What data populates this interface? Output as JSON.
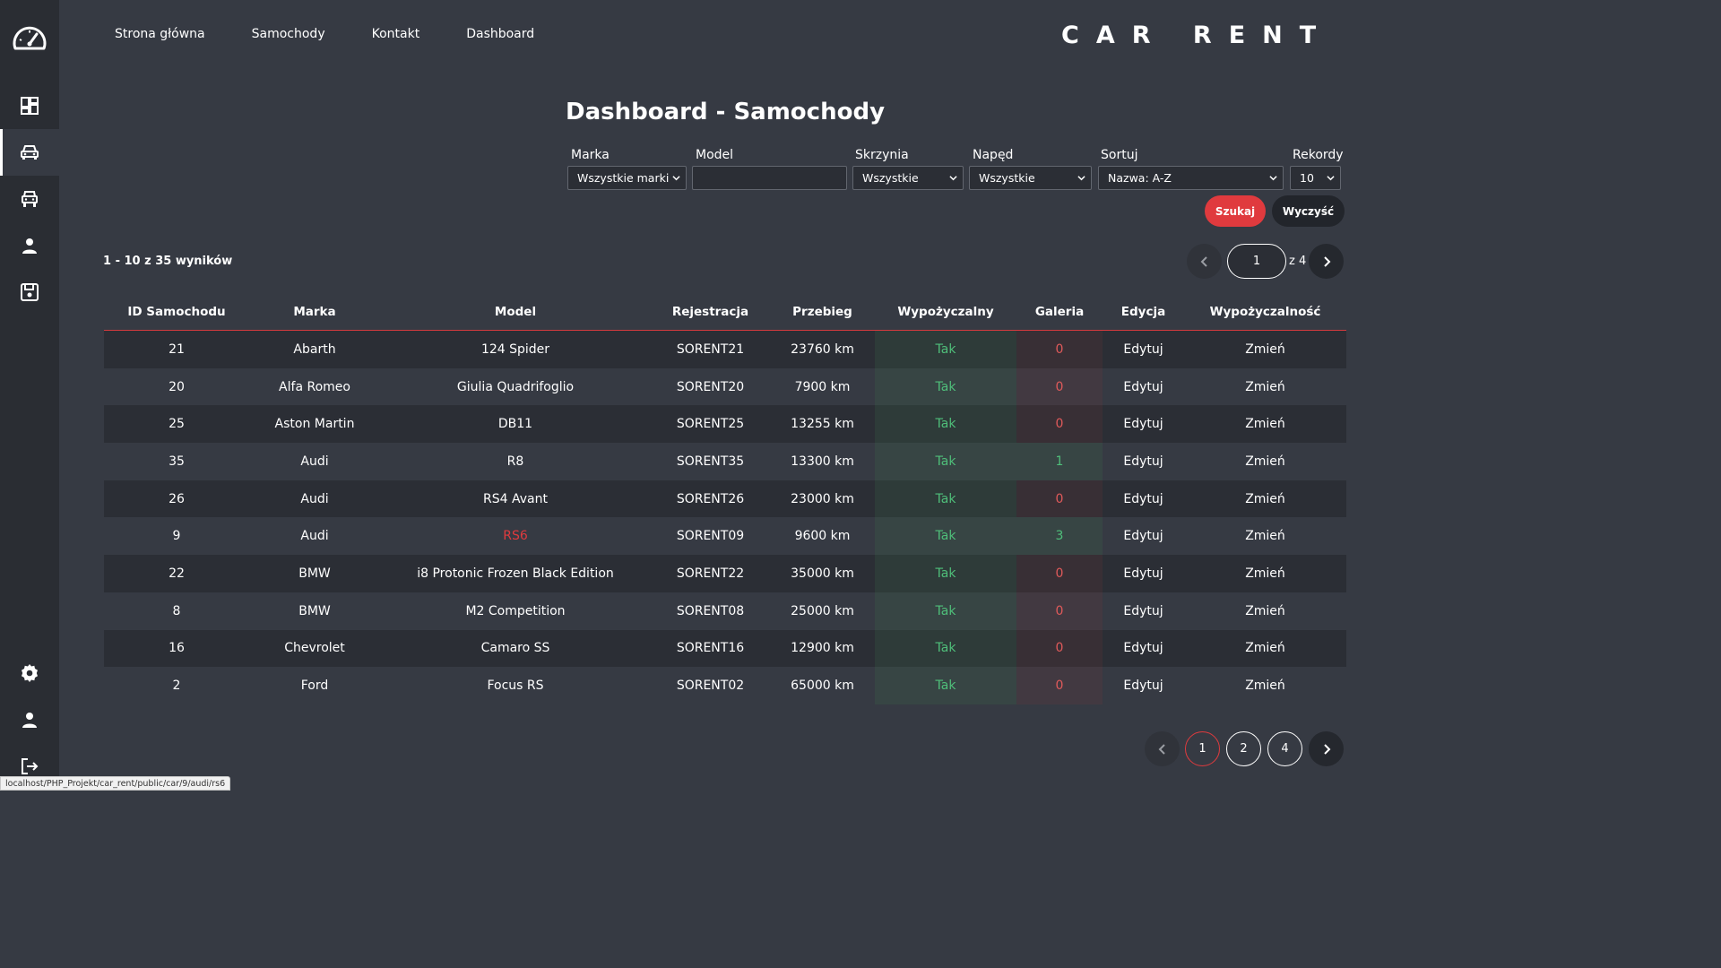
{
  "nav": {
    "links": [
      "Strona główna",
      "Samochody",
      "Kontakt",
      "Dashboard"
    ],
    "brand": "CAR RENT"
  },
  "sidebar": {
    "icons": [
      "speedometer-icon",
      "dashboard-grid-icon",
      "car-icon",
      "car-front-icon",
      "user-icon",
      "save-icon",
      "gear-icon",
      "user-icon",
      "logout-icon"
    ],
    "active": "car-icon"
  },
  "page_title": "Dashboard - Samochody",
  "filters": {
    "marka_label": "Marka",
    "marka_value": "Wszystkie marki",
    "model_label": "Model",
    "model_value": "",
    "skrzynia_label": "Skrzynia",
    "skrzynia_value": "Wszystkie",
    "naped_label": "Napęd",
    "naped_value": "Wszystkie",
    "sortuj_label": "Sortuj",
    "sortuj_value": "Nazwa: A-Z",
    "rekordy_label": "Rekordy",
    "rekordy_value": "10",
    "search_label": "Szukaj",
    "clear_label": "Wyczyść"
  },
  "results_text": "1 - 10 z 35 wyników",
  "pagination_top": {
    "current": "1",
    "of_text": "z 4"
  },
  "table": {
    "headers": [
      "ID Samochodu",
      "Marka",
      "Model",
      "Rejestracja",
      "Przebieg",
      "Wypożyczalny",
      "Galeria",
      "Edycja",
      "Wypożyczalność"
    ],
    "rows": [
      {
        "id": "21",
        "marka": "Abarth",
        "model": "124 Spider",
        "rej": "SORENT21",
        "przebieg": "23760 km",
        "wyp": "Tak",
        "galeria": "0",
        "edycja": "Edytuj",
        "zmien": "Zmień"
      },
      {
        "id": "20",
        "marka": "Alfa Romeo",
        "model": "Giulia Quadrifoglio",
        "rej": "SORENT20",
        "przebieg": "7900 km",
        "wyp": "Tak",
        "galeria": "0",
        "edycja": "Edytuj",
        "zmien": "Zmień"
      },
      {
        "id": "25",
        "marka": "Aston Martin",
        "model": "DB11",
        "rej": "SORENT25",
        "przebieg": "13255 km",
        "wyp": "Tak",
        "galeria": "0",
        "edycja": "Edytuj",
        "zmien": "Zmień"
      },
      {
        "id": "35",
        "marka": "Audi",
        "model": "R8",
        "rej": "SORENT35",
        "przebieg": "13300 km",
        "wyp": "Tak",
        "galeria": "1",
        "edycja": "Edytuj",
        "zmien": "Zmień"
      },
      {
        "id": "26",
        "marka": "Audi",
        "model": "RS4 Avant",
        "rej": "SORENT26",
        "przebieg": "23000 km",
        "wyp": "Tak",
        "galeria": "0",
        "edycja": "Edytuj",
        "zmien": "Zmień"
      },
      {
        "id": "9",
        "marka": "Audi",
        "model": "RS6",
        "rej": "SORENT09",
        "przebieg": "9600 km",
        "wyp": "Tak",
        "galeria": "3",
        "edycja": "Edytuj",
        "zmien": "Zmień",
        "hover": true
      },
      {
        "id": "22",
        "marka": "BMW",
        "model": "i8 Protonic Frozen Black Edition",
        "rej": "SORENT22",
        "przebieg": "35000 km",
        "wyp": "Tak",
        "galeria": "0",
        "edycja": "Edytuj",
        "zmien": "Zmień"
      },
      {
        "id": "8",
        "marka": "BMW",
        "model": "M2 Competition",
        "rej": "SORENT08",
        "przebieg": "25000 km",
        "wyp": "Tak",
        "galeria": "0",
        "edycja": "Edytuj",
        "zmien": "Zmień"
      },
      {
        "id": "16",
        "marka": "Chevrolet",
        "model": "Camaro SS",
        "rej": "SORENT16",
        "przebieg": "12900 km",
        "wyp": "Tak",
        "galeria": "0",
        "edycja": "Edytuj",
        "zmien": "Zmień"
      },
      {
        "id": "2",
        "marka": "Ford",
        "model": "Focus RS",
        "rej": "SORENT02",
        "przebieg": "65000 km",
        "wyp": "Tak",
        "galeria": "0",
        "edycja": "Edytuj",
        "zmien": "Zmień"
      }
    ]
  },
  "pagination_bottom": {
    "pages": [
      "1",
      "2",
      "4"
    ],
    "current": "1"
  },
  "status_url": "localhost/PHP_Projekt/car_rent/public/car/9/audi/rs6",
  "colors": {
    "accent": "#e03a3e",
    "background": "#363a43",
    "sidebar": "#2a2d33",
    "green": "#4fbf7a"
  }
}
